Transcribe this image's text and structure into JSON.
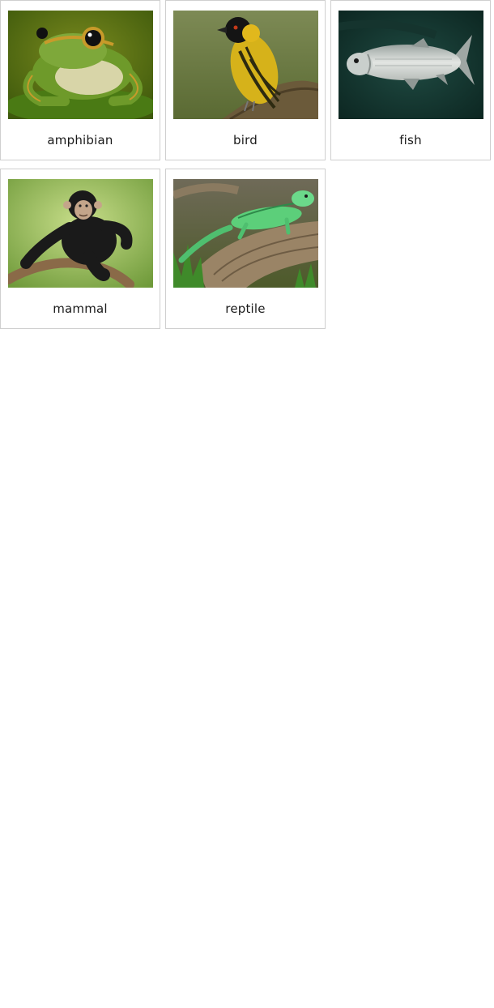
{
  "cards": [
    {
      "label": "amphibian",
      "image": "frog-photo"
    },
    {
      "label": "bird",
      "image": "weaver-bird-photo"
    },
    {
      "label": "fish",
      "image": "silver-fish-photo"
    },
    {
      "label": "mammal",
      "image": "chimpanzee-photo"
    },
    {
      "label": "reptile",
      "image": "green-iguana-photo"
    }
  ]
}
